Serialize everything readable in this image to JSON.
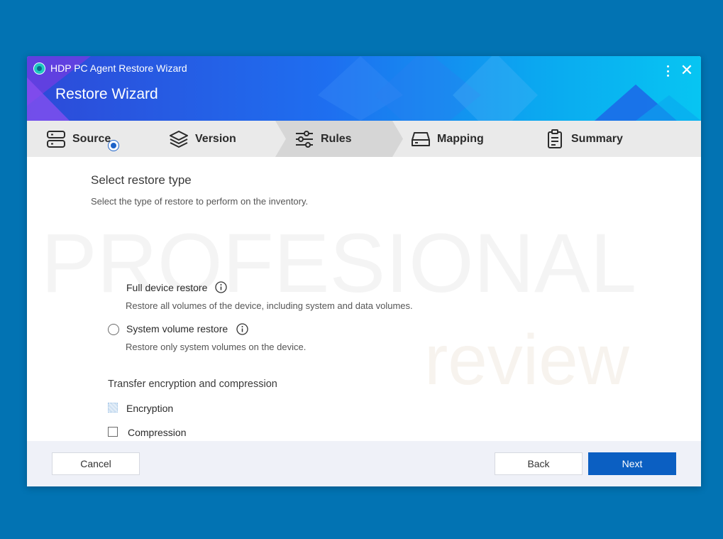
{
  "window": {
    "app_title": "HDP PC Agent Restore Wizard",
    "wizard_title": "Restore Wizard",
    "icons": {
      "more": "more-vertical-icon",
      "close": "close-icon",
      "app": "app-logo-icon"
    },
    "close_glyph": "✕"
  },
  "steps": [
    {
      "label": "Source",
      "icon": "server-icon",
      "active": false
    },
    {
      "label": "Version",
      "icon": "layers-icon",
      "active": false
    },
    {
      "label": "Rules",
      "icon": "sliders-icon",
      "active": true
    },
    {
      "label": "Mapping",
      "icon": "drive-icon",
      "active": false
    },
    {
      "label": "Summary",
      "icon": "clipboard-list-icon",
      "active": false
    }
  ],
  "restore_type": {
    "heading": "Select restore type",
    "description": "Select the type of restore to perform on the inventory.",
    "options": [
      {
        "label": "Full device restore",
        "description": "Restore all volumes of the device, including system and data volumes.",
        "selected": true
      },
      {
        "label": "System volume restore",
        "description": "Restore only system volumes on the device.",
        "selected": false
      }
    ]
  },
  "transfer": {
    "heading": "Transfer encryption and compression",
    "options": [
      {
        "label": "Encryption",
        "checked": false,
        "disabled": true
      },
      {
        "label": "Compression",
        "checked": false,
        "disabled": false
      }
    ]
  },
  "footer": {
    "cancel_label": "Cancel",
    "back_label": "Back",
    "next_label": "Next"
  },
  "colors": {
    "background": "#0273b3",
    "accent": "#0b5fc2",
    "radio_selected": "#1e63c9",
    "steps_bar": "#eaeaea",
    "footer": "#eff1f8"
  },
  "watermark": {
    "line1": "PROFESIONAL",
    "line2": "review"
  }
}
